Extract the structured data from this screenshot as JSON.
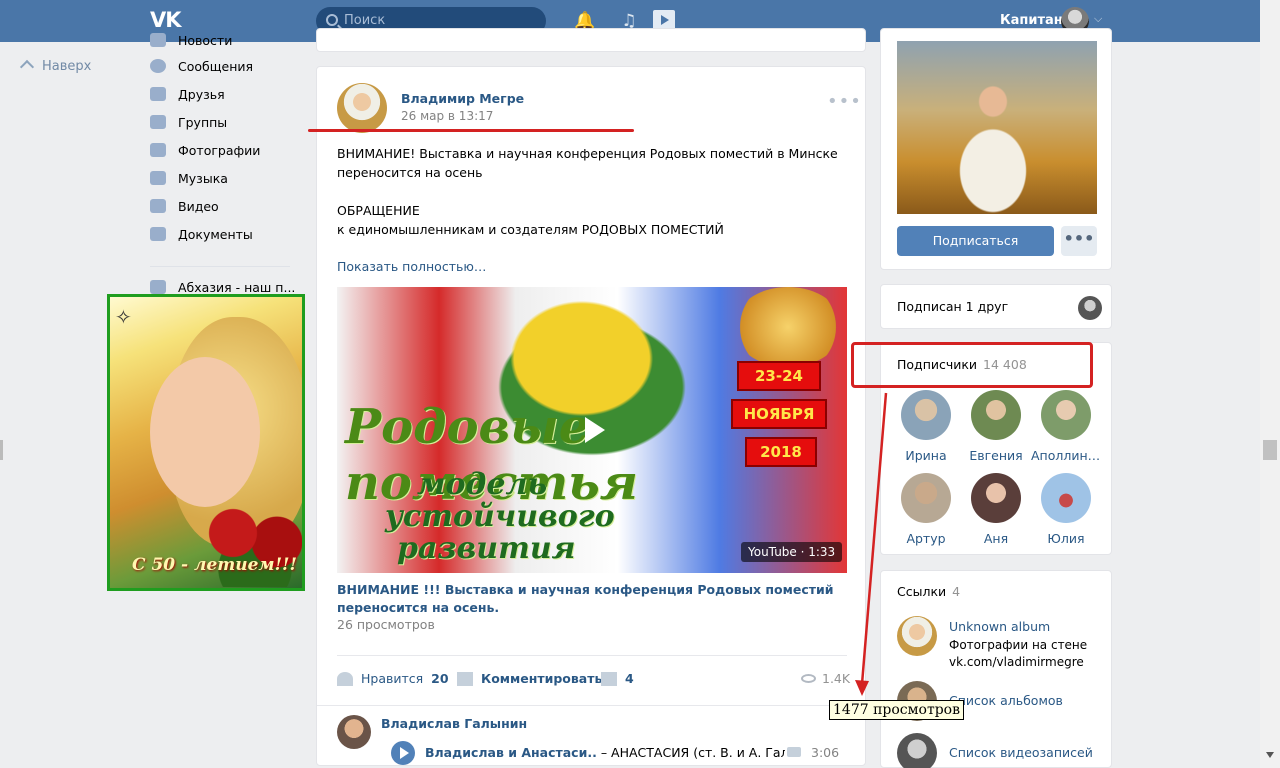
{
  "topbar": {
    "logo": "VK",
    "search_placeholder": "Поиск",
    "user_name": "Капитан"
  },
  "left": {
    "up_label": "Наверх",
    "menu": [
      {
        "label": "Новости",
        "icon": "news-icon"
      },
      {
        "label": "Сообщения",
        "icon": "messages-icon"
      },
      {
        "label": "Друзья",
        "icon": "friends-icon"
      },
      {
        "label": "Группы",
        "icon": "groups-icon"
      },
      {
        "label": "Фотографии",
        "icon": "camera-icon"
      },
      {
        "label": "Музыка",
        "icon": "music-icon"
      },
      {
        "label": "Видео",
        "icon": "video-icon"
      },
      {
        "label": "Документы",
        "icon": "document-icon"
      }
    ],
    "group_link": "Абхазия - наш п...",
    "banner_text": "С 50 - летием!!!"
  },
  "post": {
    "author": "Владимир Мегре",
    "date": "26 мар в 13:17",
    "text_line1": "ВНИМАНИЕ! Выставка и научная конференция Родовых поместий в Минске",
    "text_line2": "переносится на осень",
    "text_line3": "ОБРАЩЕНИЕ",
    "text_line4": "к единомышленникам и создателям РОДОВЫХ ПОМЕСТИЙ",
    "show_more": "Показать полностью…",
    "video": {
      "title_big1": "Родовые поместья",
      "title_big2": "модель",
      "title_big3": "устойчивого",
      "title_big4": "развития",
      "date1": "23-24",
      "date2": "НОЯБРЯ",
      "date3": "2018",
      "badge": "YouTube · 1:33"
    },
    "video_title": "ВНИМАНИЕ !!! Выставка и научная конференция Родовых поместий переносится на осень.",
    "video_views": "26 просмотров",
    "like_label": "Нравится",
    "like_count": "20",
    "comment_label": "Комментировать",
    "share_count": "4",
    "views": "1.4K",
    "comment": {
      "author": "Владислав Галынин",
      "track_artist": "Владислав и Анастаси..",
      "track_title": " – АНАСТАСИЯ (ст. В. и А. Галынин...",
      "duration": "3:06"
    }
  },
  "right": {
    "subscribe_label": "Подписаться",
    "more_label": "•••",
    "friend_sub": "Подписан 1 друг",
    "subs_label": "Подписчики",
    "subs_count": "14 408",
    "subscribers": [
      {
        "name": "Ирина",
        "color": "#8aa3b8"
      },
      {
        "name": "Евгения",
        "color": "#6e8a52"
      },
      {
        "name": "Аполлина...",
        "color": "#7e9c6a"
      },
      {
        "name": "Артур",
        "color": "#b7a894"
      },
      {
        "name": "Аня",
        "color": "#5a3e3a"
      },
      {
        "name": "Юлия",
        "color": "#9fc3e6"
      }
    ],
    "links_label": "Ссылки",
    "links_count": "4",
    "links": [
      {
        "title": "Unknown album",
        "sub1": "Фотографии на стене",
        "sub2": "vk.com/vladimirmegre"
      },
      {
        "title": "Список альбомов"
      },
      {
        "title": "Список видеозаписей"
      }
    ]
  },
  "annotation": {
    "tooltip": "1477 просмотров"
  }
}
